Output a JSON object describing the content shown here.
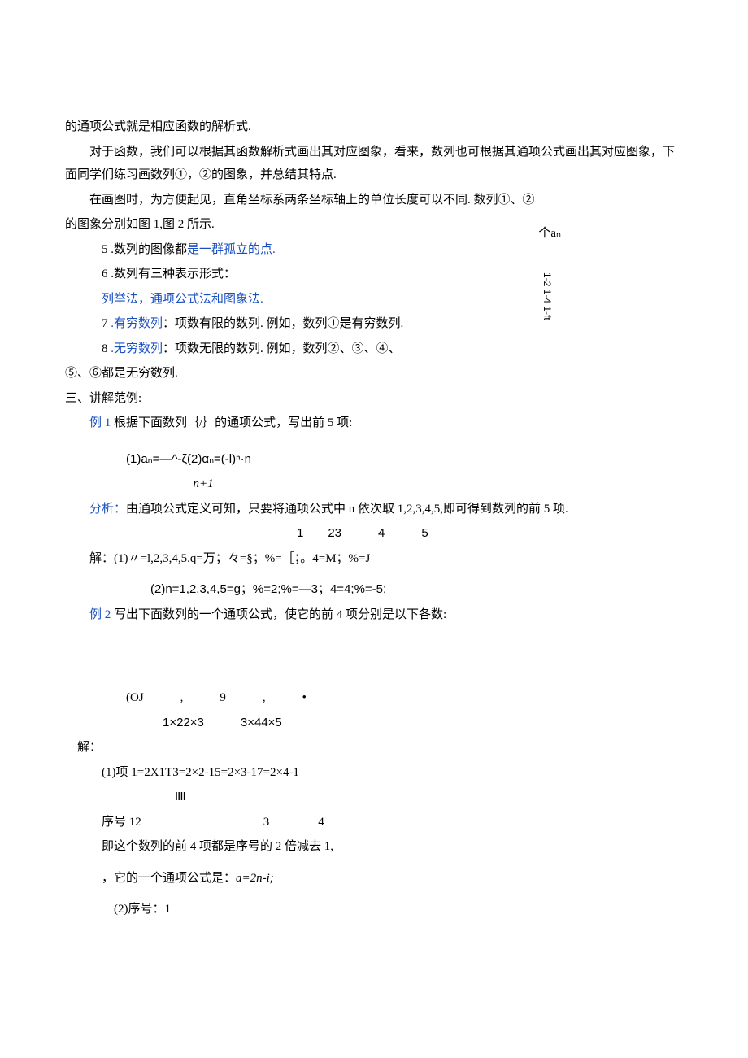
{
  "p1": "的通项公式就是相应函数的解析式.",
  "p2": "对于函数，我们可以根据其函数解析式画出其对应图象，看来，数列也可根据其通项公式画出其对应图象，下面同学们练习画数列①，②的图象，并总结其特点.",
  "p3a": "在画图时，为方便起见，直角坐标系两条坐标轴上的单位长度可以不同. 数列①、②",
  "p3b": "的图象分别如图 1,图 2 所示.",
  "item5_num": "5",
  "item5_a": ".数列的图像都",
  "item5_b": "是一群孤立的点.",
  "item6_num": "6",
  "item6": ".数列有三种表示形式：",
  "item6_sub": "列举法，通项公式法和图象法.",
  "item7_num": "7",
  "item7_a": ".有穷数列",
  "item7_b": "：项数有限的数列. 例如，数列①是有穷数列.",
  "item8_num": "8",
  "item8_a": ".无穷数列",
  "item8_b": "：项数无限的数列. 例如，数列②、③、④、",
  "item8_cont": "⑤、⑥都是无穷数列.",
  "sec3": "三、讲解范例:",
  "ex1_label": "例 1 ",
  "ex1_text": "根据下面数列｛/｝的通项公式，写出前 5 项:",
  "formula1": "(1)aₙ=—^-ζ(2)αₙ=(-l)ⁿ·n",
  "formula1b": "n+1",
  "analysis_label": "分析：",
  "analysis_text": "由通项公式定义可知，只要将通项公式中 n 依次取 1,2,3,4,5,即可得到数列的前 5 项.",
  "nums_row": "1　　23　　　4　　　5",
  "solve1": "解：(1)〃=l,2,3,4,5.q=万；々=§；%=［；。4=M；%=J",
  "solve2": "(2)n=1,2,3,4,5=g；%=2;%=—3；4=4;%=-5;",
  "ex2_label": "例 2 ",
  "ex2_text": "写出下面数列的一个通项公式，使它的前 4 项分别是以下各数:",
  "oj_line": "(OJ　　　,　　　9　　　,　　　•",
  "oj_line2": "1×22×3　　　3×44×5",
  "solve_h": "解：",
  "s_item1": "(1)项 1=2X1T3=2×2-15=2×3-17=2×4-1",
  "s_bars": "IIII",
  "s_seq": "序号 12　　　　　　　　　　3　　　　4",
  "s_desc": "即这个数列的前 4 项都是序号的 2 倍减去 1,",
  "s_formula_a": "，它的一个通项公式是：",
  "s_formula_b": "a=2n-i;",
  "s_item2": "(2)序号：1",
  "graph_an": "个aₙ",
  "graph_ticks": "1-2 1-4 1-ft"
}
